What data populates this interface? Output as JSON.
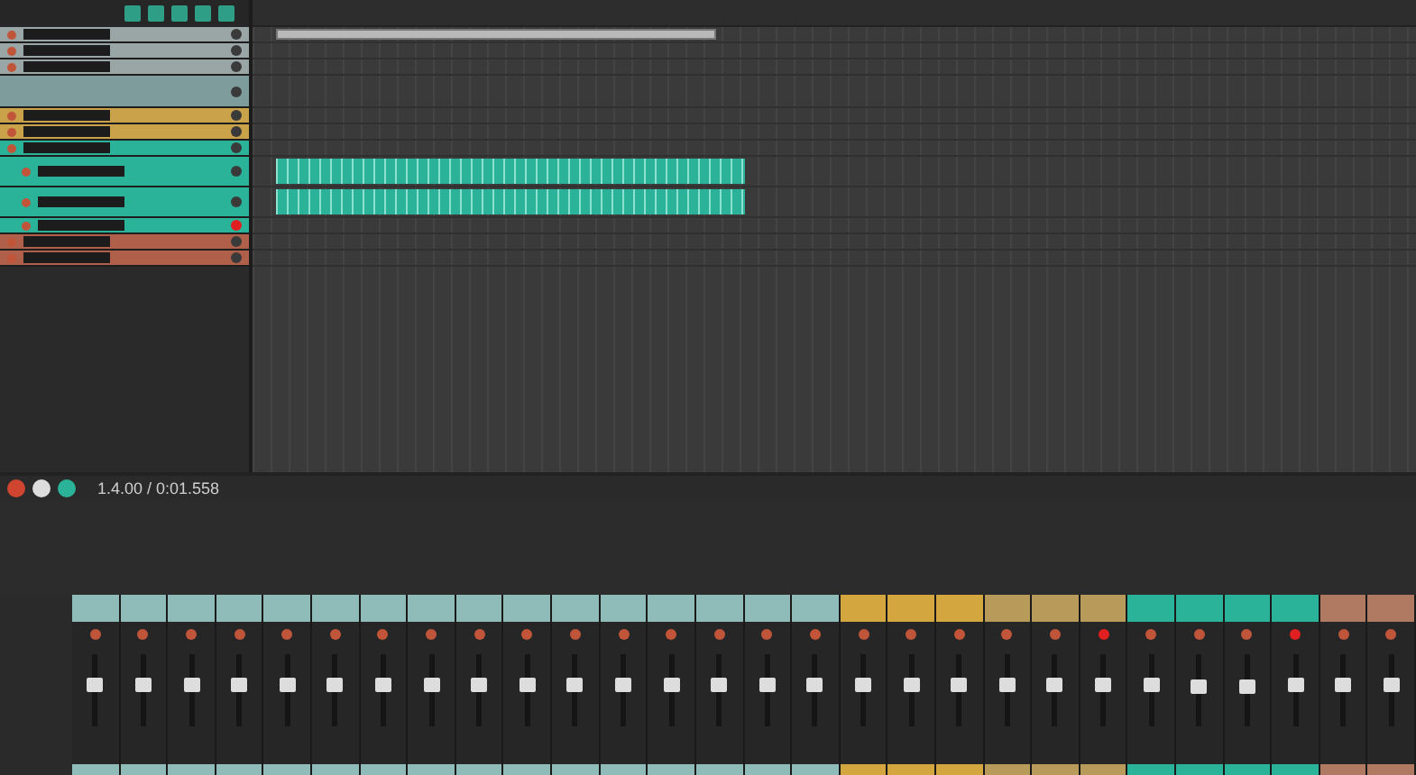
{
  "transport": {
    "time": "1.4.00 / 0:01.558",
    "recording": true
  },
  "tracks": [
    {
      "kind": "track",
      "color": "#9aa5a5",
      "armed": false,
      "clip": {
        "kind": "audio"
      }
    },
    {
      "kind": "track",
      "color": "#9aa5a5",
      "armed": false
    },
    {
      "kind": "track",
      "color": "#9aa5a5",
      "armed": false
    },
    {
      "kind": "folder",
      "color": "#7f9c9c",
      "armed": false
    },
    {
      "kind": "track",
      "color": "#c9a24a",
      "armed": false
    },
    {
      "kind": "track",
      "color": "#c9a24a",
      "armed": false
    },
    {
      "kind": "track",
      "color": "#2bb39a",
      "armed": false,
      "children": [
        {
          "kind": "tall",
          "color": "#2bb39a",
          "armed": false,
          "clip": {
            "kind": "midi"
          }
        },
        {
          "kind": "tall",
          "color": "#2bb39a",
          "armed": false,
          "clip": {
            "kind": "midi"
          }
        },
        {
          "kind": "track",
          "color": "#2bb39a",
          "armed": true
        }
      ]
    },
    {
      "kind": "track",
      "color": "#b0604a",
      "armed": false
    },
    {
      "kind": "track",
      "color": "#b0604a",
      "armed": false
    }
  ],
  "mixer": [
    {
      "color": "#8fbcb8",
      "armed": false,
      "level": 0.6
    },
    {
      "color": "#8fbcb8",
      "armed": false,
      "level": 0.6
    },
    {
      "color": "#8fbcb8",
      "armed": false,
      "level": 0.6
    },
    {
      "color": "#8fbcb8",
      "armed": false,
      "level": 0.6
    },
    {
      "color": "#8fbcb8",
      "armed": false,
      "level": 0.6
    },
    {
      "color": "#8fbcb8",
      "armed": false,
      "level": 0.6
    },
    {
      "color": "#8fbcb8",
      "armed": false,
      "level": 0.6
    },
    {
      "color": "#8fbcb8",
      "armed": false,
      "level": 0.6
    },
    {
      "color": "#8fbcb8",
      "armed": false,
      "level": 0.6
    },
    {
      "color": "#8fbcb8",
      "armed": false,
      "level": 0.6
    },
    {
      "color": "#8fbcb8",
      "armed": false,
      "level": 0.6
    },
    {
      "color": "#8fbcb8",
      "armed": false,
      "level": 0.6
    },
    {
      "color": "#8fbcb8",
      "armed": false,
      "level": 0.6
    },
    {
      "color": "#8fbcb8",
      "armed": false,
      "level": 0.6
    },
    {
      "color": "#8fbcb8",
      "armed": false,
      "level": 0.6
    },
    {
      "color": "#8fbcb8",
      "armed": false,
      "level": 0.6
    },
    {
      "color": "#d4a640",
      "armed": false,
      "level": 0.6
    },
    {
      "color": "#d4a640",
      "armed": false,
      "level": 0.6
    },
    {
      "color": "#d4a640",
      "armed": false,
      "level": 0.6
    },
    {
      "color": "#b89a5a",
      "armed": false,
      "level": 0.6
    },
    {
      "color": "#b89a5a",
      "armed": false,
      "level": 0.6
    },
    {
      "color": "#b89a5a",
      "armed": true,
      "level": 0.6
    },
    {
      "color": "#2bb39a",
      "armed": false,
      "level": 0.6
    },
    {
      "color": "#2bb39a",
      "armed": false,
      "level": 0.55
    },
    {
      "color": "#2bb39a",
      "armed": false,
      "level": 0.55
    },
    {
      "color": "#2bb39a",
      "armed": true,
      "level": 0.6
    },
    {
      "color": "#b07a62",
      "armed": false,
      "level": 0.6
    },
    {
      "color": "#b07a62",
      "armed": false,
      "level": 0.6
    }
  ]
}
